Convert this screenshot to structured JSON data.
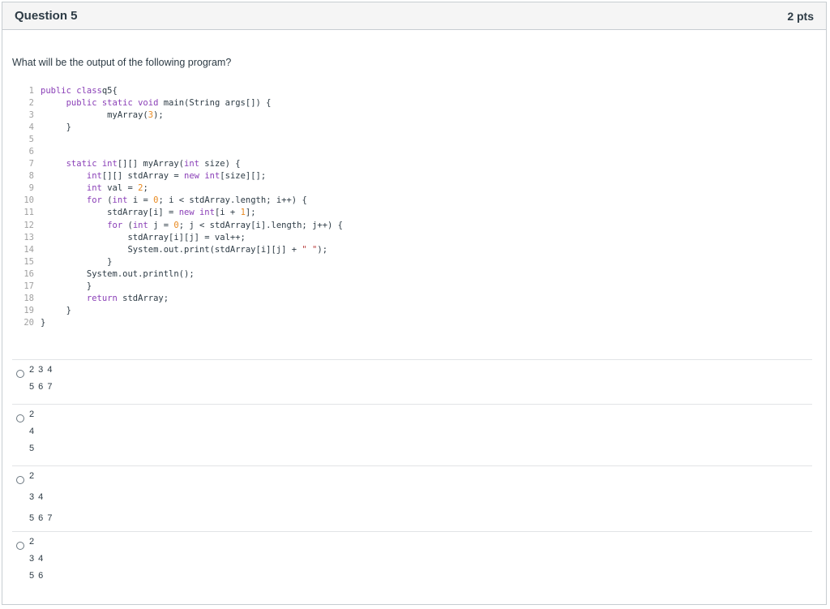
{
  "question": {
    "title": "Question 5",
    "points": "2 pts",
    "prompt": "What will be the output of the following program?"
  },
  "code": [
    {
      "n": "1",
      "segs": [
        [
          "kw",
          "public class"
        ],
        [
          "",
          "q5{"
        ]
      ]
    },
    {
      "n": "2",
      "segs": [
        [
          "",
          "     "
        ],
        [
          "kw",
          "public static void"
        ],
        [
          "",
          " main(String args[]) {"
        ]
      ]
    },
    {
      "n": "3",
      "segs": [
        [
          "",
          "             myArray("
        ],
        [
          "num",
          "3"
        ],
        [
          "",
          ");"
        ]
      ]
    },
    {
      "n": "4",
      "segs": [
        [
          "",
          "     }"
        ]
      ]
    },
    {
      "n": "5",
      "segs": []
    },
    {
      "n": "6",
      "segs": []
    },
    {
      "n": "7",
      "segs": [
        [
          "",
          "     "
        ],
        [
          "kw",
          "static int"
        ],
        [
          "",
          "[][] myArray("
        ],
        [
          "kw",
          "int"
        ],
        [
          "",
          " size) {"
        ]
      ]
    },
    {
      "n": "8",
      "segs": [
        [
          "",
          "         "
        ],
        [
          "kw",
          "int"
        ],
        [
          "",
          "[][] stdArray = "
        ],
        [
          "kw",
          "new int"
        ],
        [
          "",
          "[size][];"
        ]
      ]
    },
    {
      "n": "9",
      "segs": [
        [
          "",
          "         "
        ],
        [
          "kw",
          "int"
        ],
        [
          "",
          " val = "
        ],
        [
          "num",
          "2"
        ],
        [
          "",
          ";"
        ]
      ]
    },
    {
      "n": "10",
      "segs": [
        [
          "",
          "         "
        ],
        [
          "kw",
          "for"
        ],
        [
          "",
          " ("
        ],
        [
          "kw",
          "int"
        ],
        [
          "",
          " i = "
        ],
        [
          "num",
          "0"
        ],
        [
          "",
          "; i < stdArray.length; i++) {"
        ]
      ]
    },
    {
      "n": "11",
      "segs": [
        [
          "",
          "             stdArray[i] = "
        ],
        [
          "kw",
          "new int"
        ],
        [
          "",
          "[i + "
        ],
        [
          "num",
          "1"
        ],
        [
          "",
          "];"
        ]
      ]
    },
    {
      "n": "12",
      "segs": [
        [
          "",
          "             "
        ],
        [
          "kw",
          "for"
        ],
        [
          "",
          " ("
        ],
        [
          "kw",
          "int"
        ],
        [
          "",
          " j = "
        ],
        [
          "num",
          "0"
        ],
        [
          "",
          "; j < stdArray[i].length; j++) {"
        ]
      ]
    },
    {
      "n": "13",
      "segs": [
        [
          "",
          "                 stdArray[i][j] = val++;"
        ]
      ]
    },
    {
      "n": "14",
      "segs": [
        [
          "",
          "                 System.out.print(stdArray[i][j] + "
        ],
        [
          "str",
          "\" \""
        ],
        [
          "",
          ");"
        ]
      ]
    },
    {
      "n": "15",
      "segs": [
        [
          "",
          "             }"
        ]
      ]
    },
    {
      "n": "16",
      "segs": [
        [
          "",
          "         System.out.println();"
        ]
      ]
    },
    {
      "n": "17",
      "segs": [
        [
          "",
          "         }"
        ]
      ]
    },
    {
      "n": "18",
      "segs": [
        [
          "",
          "         "
        ],
        [
          "kw",
          "return"
        ],
        [
          "",
          " stdArray;"
        ]
      ]
    },
    {
      "n": "19",
      "segs": [
        [
          "",
          "     }"
        ]
      ]
    },
    {
      "n": "20",
      "segs": [
        [
          "",
          "}"
        ]
      ]
    }
  ],
  "answers": [
    {
      "lines": [
        "2 3 4",
        "5 6 7"
      ]
    },
    {
      "lines": [
        "2",
        "4",
        "5"
      ]
    },
    {
      "lines": [
        "2",
        "3 4",
        "5 6 7"
      ]
    },
    {
      "lines": [
        "2",
        "3 4",
        "5 6"
      ]
    }
  ]
}
